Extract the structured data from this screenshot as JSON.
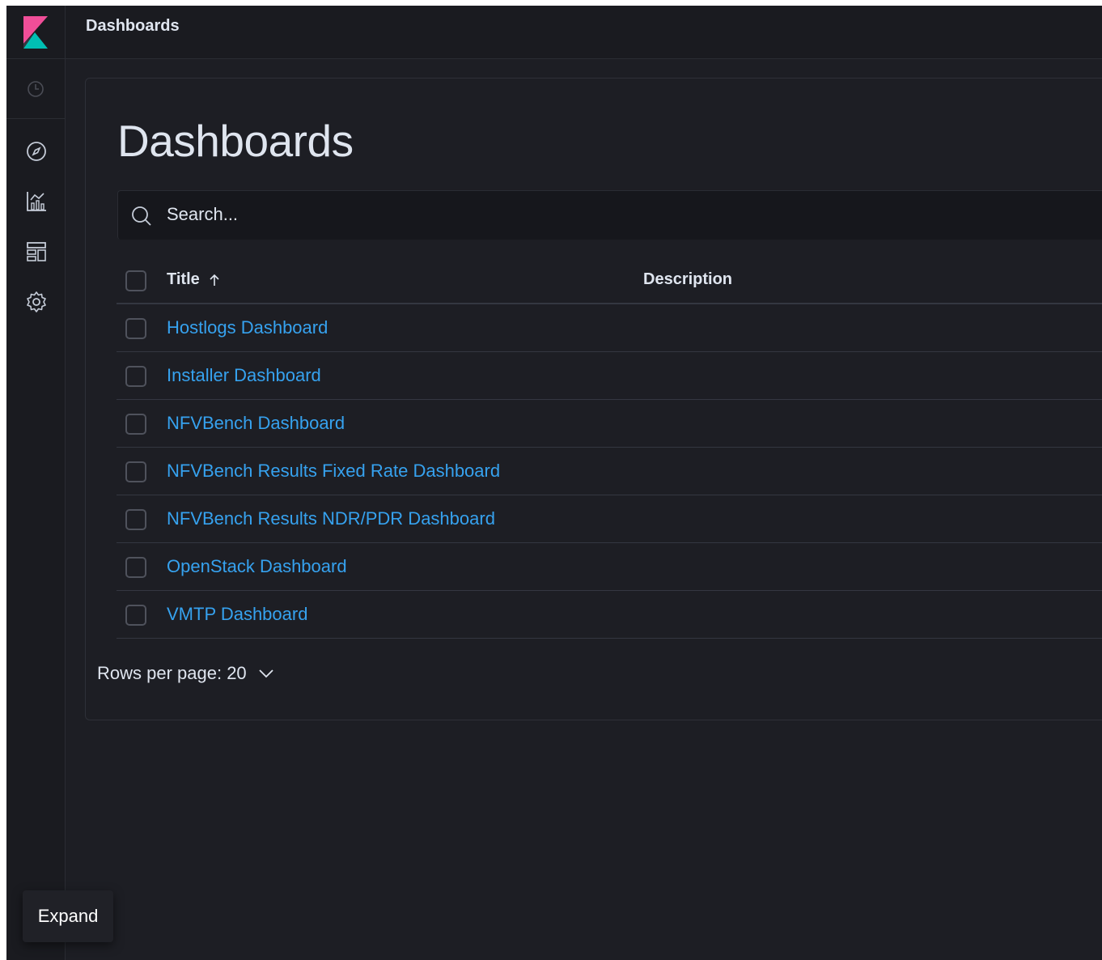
{
  "header": {
    "breadcrumb": "Dashboards"
  },
  "sidenav": {
    "items": [
      {
        "icon": "clock-icon",
        "label": ""
      },
      {
        "icon": "compass-icon",
        "label": ""
      },
      {
        "icon": "visualize-icon",
        "label": ""
      },
      {
        "icon": "dashboard-icon",
        "label": ""
      },
      {
        "icon": "gear-icon",
        "label": ""
      }
    ],
    "expand_label": "Expand"
  },
  "main": {
    "title": "Dashboards",
    "search": {
      "placeholder": "Search...",
      "value": ""
    },
    "table": {
      "columns": {
        "title": "Title",
        "description": "Description"
      },
      "sort": {
        "column": "Title",
        "direction": "ascending"
      },
      "rows": [
        {
          "title": "Hostlogs Dashboard",
          "description": ""
        },
        {
          "title": "Installer Dashboard",
          "description": ""
        },
        {
          "title": "NFVBench Dashboard",
          "description": ""
        },
        {
          "title": "NFVBench Results Fixed Rate Dashboard",
          "description": ""
        },
        {
          "title": "NFVBench Results NDR/PDR Dashboard",
          "description": ""
        },
        {
          "title": "OpenStack Dashboard",
          "description": ""
        },
        {
          "title": "VMTP Dashboard",
          "description": ""
        }
      ]
    },
    "pagination": {
      "rows_per_page": "Rows per page: 20"
    }
  },
  "colors": {
    "background": "#1d1e24",
    "link": "#36a2ef",
    "text": "#dfe5ef",
    "logo_pink": "#f04e98",
    "logo_teal": "#00bfb3"
  }
}
